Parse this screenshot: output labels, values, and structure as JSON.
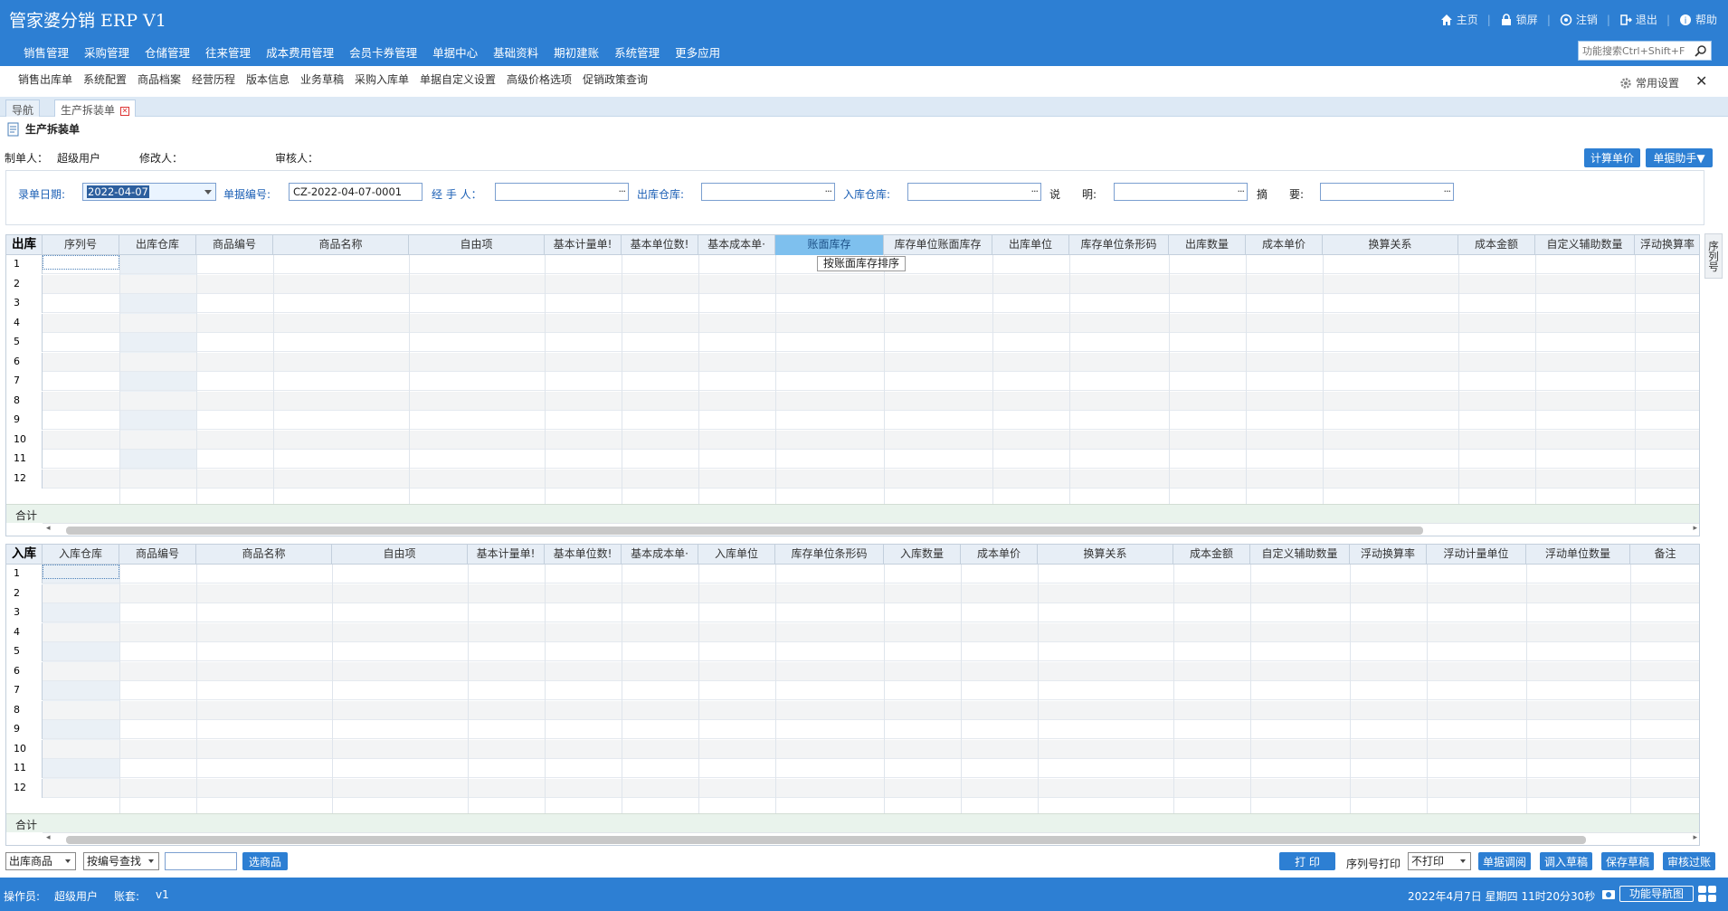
{
  "header": {
    "title": "管家婆分销 ERP V1",
    "top_links": [
      "主页",
      "锁屏",
      "注销",
      "退出",
      "帮助"
    ],
    "main_menu": [
      "销售管理",
      "采购管理",
      "仓储管理",
      "往来管理",
      "成本费用管理",
      "会员卡券管理",
      "单据中心",
      "基础资料",
      "期初建账",
      "系统管理",
      "更多应用"
    ],
    "search_placeholder": "功能搜索Ctrl+Shift+F"
  },
  "submenu": {
    "items": [
      "销售出库单",
      "系统配置",
      "商品档案",
      "经营历程",
      "版本信息",
      "业务草稿",
      "采购入库单",
      "单据自定义设置",
      "高级价格选项",
      "促销政策查询"
    ],
    "common_settings": "常用设置",
    "close": "✕"
  },
  "tabs": [
    "导航",
    "生产拆装单"
  ],
  "document": {
    "title": "生产拆装单",
    "maker_label": "制单人：",
    "maker_value": "超级用户",
    "modifier_label": "修改人：",
    "auditor_label": "审核人：",
    "calc_price_button": "计算单价",
    "assistant_button": "单据助手▼"
  },
  "form": {
    "date_label": "录单日期:",
    "date_value": "2022-04-07",
    "number_label": "单据编号:",
    "number_value": "CZ-2022-04-07-0001",
    "handler_label": "经 手 人：",
    "out_warehouse_label": "出库仓库:",
    "in_warehouse_label": "入库仓库:",
    "explain_label": "说　　明:",
    "summary_label": "摘　　要:",
    "dots": "···"
  },
  "out_grid": {
    "corner": "出库",
    "columns": [
      "序列号",
      "出库仓库",
      "商品编号",
      "商品名称",
      "自由项",
      "基本计量单!",
      "基本单位数!",
      "基本成本单·",
      "账面库存",
      "库存单位账面库存",
      "出库单位",
      "库存单位条形码",
      "出库数量",
      "成本单价",
      "换算关系",
      "成本金额",
      "自定义辅助数量",
      "浮动换算率"
    ],
    "rows": [
      "1",
      "2",
      "3",
      "4",
      "5",
      "6",
      "7",
      "8",
      "9",
      "10",
      "11",
      "12"
    ],
    "total_label": "合计",
    "sort_button": "按账面库存排序",
    "side_tab": "序列号"
  },
  "in_grid": {
    "corner": "入库",
    "columns": [
      "入库仓库",
      "商品编号",
      "商品名称",
      "自由项",
      "基本计量单!",
      "基本单位数!",
      "基本成本单·",
      "入库单位",
      "库存单位条形码",
      "入库数量",
      "成本单价",
      "换算关系",
      "成本金额",
      "自定义辅助数量",
      "浮动换算率",
      "浮动计量单位",
      "浮动单位数量",
      "备注"
    ],
    "rows": [
      "1",
      "2",
      "3",
      "4",
      "5",
      "6",
      "7",
      "8",
      "9",
      "10",
      "11",
      "12"
    ],
    "total_label": "合计"
  },
  "bottom_bar": {
    "goods_select": "出库商品",
    "search_mode": "按编号查找",
    "search_input": "",
    "select_goods_button": "选商品",
    "print_button": "打 印",
    "serial_print_label": "序列号打印",
    "serial_print_value": "不打印",
    "buttons": [
      "单据调阅",
      "调入草稿",
      "保存草稿",
      "审核过账"
    ]
  },
  "status_bar": {
    "operator_label": "操作员:",
    "operator_value": "超级用户",
    "account_label": "账套:",
    "account_value": "v1",
    "datetime": "2022年4月7日  星期四  11时20分30秒",
    "nav_button": "功能导航图"
  },
  "colors": {
    "brand": "#2d7fd3",
    "grid_header": "#e7eef6",
    "highlight_column": "#7ec0ee",
    "total_row": "#e9f3ec"
  }
}
